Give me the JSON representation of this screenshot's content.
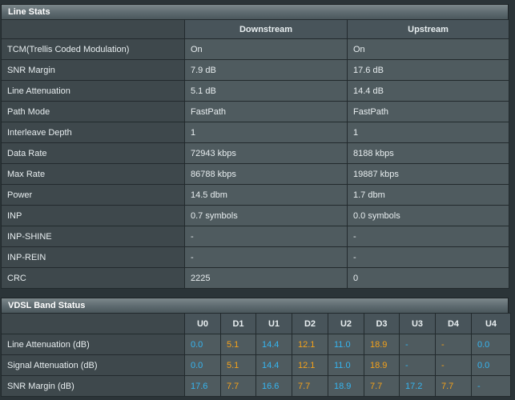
{
  "line_stats": {
    "title": "Line Stats",
    "columns": [
      "Downstream",
      "Upstream"
    ],
    "rows": [
      {
        "label": "TCM(Trellis Coded Modulation)",
        "down": "On",
        "up": "On"
      },
      {
        "label": "SNR Margin",
        "down": "7.9 dB",
        "up": "17.6 dB"
      },
      {
        "label": "Line Attenuation",
        "down": "5.1 dB",
        "up": "14.4 dB"
      },
      {
        "label": "Path Mode",
        "down": "FastPath",
        "up": "FastPath"
      },
      {
        "label": "Interleave Depth",
        "down": "1",
        "up": "1"
      },
      {
        "label": "Data Rate",
        "down": "72943 kbps",
        "up": "8188 kbps"
      },
      {
        "label": "Max Rate",
        "down": "86788 kbps",
        "up": "19887 kbps"
      },
      {
        "label": "Power",
        "down": "14.5 dbm",
        "up": "1.7 dbm"
      },
      {
        "label": "INP",
        "down": "0.7 symbols",
        "up": "0.0 symbols"
      },
      {
        "label": "INP-SHINE",
        "down": "-",
        "up": "-"
      },
      {
        "label": "INP-REIN",
        "down": "-",
        "up": "-"
      },
      {
        "label": "CRC",
        "down": "2225",
        "up": "0"
      }
    ]
  },
  "vdsl_band_status": {
    "title": "VDSL Band Status",
    "bands": [
      "U0",
      "D1",
      "U1",
      "D2",
      "U2",
      "D3",
      "U3",
      "D4",
      "U4"
    ],
    "rows": [
      {
        "label": "Line Attenuation (dB)",
        "values": [
          "0.0",
          "5.1",
          "14.4",
          "12.1",
          "11.0",
          "18.9",
          "-",
          "-",
          "0.0"
        ]
      },
      {
        "label": "Signal Attenuation (dB)",
        "values": [
          "0.0",
          "5.1",
          "14.4",
          "12.1",
          "11.0",
          "18.9",
          "-",
          "-",
          "0.0"
        ]
      },
      {
        "label": "SNR Margin (dB)",
        "values": [
          "17.6",
          "7.7",
          "16.6",
          "7.7",
          "18.9",
          "7.7",
          "17.2",
          "7.7",
          "-"
        ]
      }
    ],
    "colors": {
      "upstream": "#36b5f0",
      "downstream": "#f5a21a"
    }
  }
}
